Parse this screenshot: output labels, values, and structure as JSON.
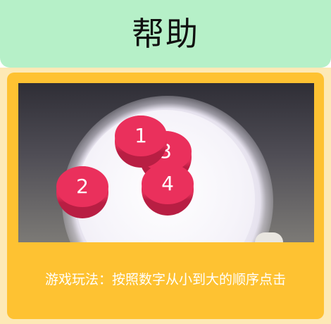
{
  "header": {
    "title": "帮助"
  },
  "game": {
    "balls": [
      {
        "number": "3"
      },
      {
        "number": "4"
      },
      {
        "number": "1"
      },
      {
        "number": "2"
      }
    ]
  },
  "help": {
    "rules_text": "游戏玩法：按照数字从小到大的顺序点击"
  },
  "colors": {
    "header_bg": "#b6f0c8",
    "panel_bg": "#fec232",
    "panel_outer_bg": "#fde9b6",
    "ball": "#e9315b"
  }
}
